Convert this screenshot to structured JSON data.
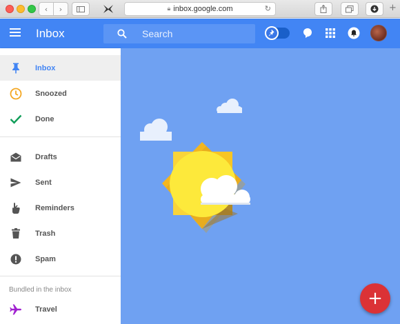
{
  "browser": {
    "url": "inbox.google.com",
    "icons": [
      "back-icon",
      "forward-icon",
      "sidebar-icon",
      "lock-icon",
      "reload-icon",
      "share-icon",
      "tabs-icon",
      "download-icon",
      "new-tab-icon"
    ]
  },
  "header": {
    "title": "Inbox",
    "search_placeholder": "Search",
    "color": "#4285f4"
  },
  "sidebar": {
    "primary": [
      {
        "label": "Inbox",
        "icon": "pin-icon",
        "active": true
      },
      {
        "label": "Snoozed",
        "icon": "clock-icon"
      },
      {
        "label": "Done",
        "icon": "checkmark-icon"
      }
    ],
    "secondary": [
      {
        "label": "Drafts",
        "icon": "drafts-icon"
      },
      {
        "label": "Sent",
        "icon": "send-icon"
      },
      {
        "label": "Reminders",
        "icon": "reminder-hand-icon"
      },
      {
        "label": "Trash",
        "icon": "trash-icon"
      },
      {
        "label": "Spam",
        "icon": "spam-icon"
      }
    ],
    "bundled_label": "Bundled in the inbox",
    "bundles": [
      {
        "label": "Travel",
        "icon": "airplane-icon"
      }
    ]
  },
  "main": {
    "state": "inbox-zero-sun-illustration",
    "background": "#6fa1f2"
  },
  "fab": {
    "label": "+",
    "color": "#db3236"
  }
}
